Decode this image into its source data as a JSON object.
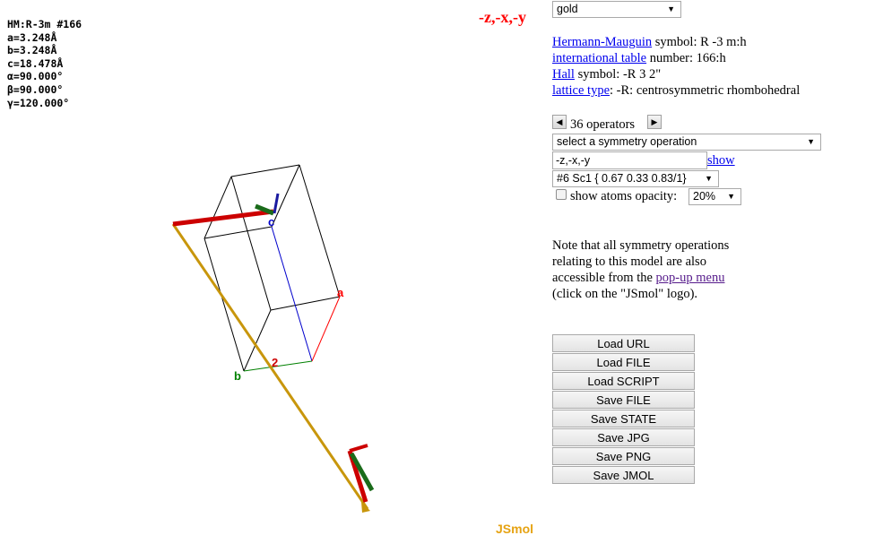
{
  "viewer": {
    "cell_info": [
      "HM:R-3m #166",
      "a=3.248Å",
      "b=3.248Å",
      "c=18.478Å",
      "α=90.000°",
      "β=90.000°",
      "γ=120.000°"
    ],
    "operation_echo": "-z,-x,-y",
    "logo": "JSmol",
    "axis_labels": {
      "a": "a",
      "b": "b",
      "c": "c"
    },
    "colors": {
      "echo": "#ff0000",
      "logo": "#e6a313",
      "axis_a": "#ff0000",
      "axis_b": "#008000",
      "axis_c": "#0000cc",
      "vector": "#c8960c",
      "frame": "#000000"
    }
  },
  "panel": {
    "color_select": "gold",
    "hm_link": "Hermann-Mauguin",
    "hm_text": " symbol: R -3 m:h",
    "it_link": "international table",
    "it_text": " number: 166:h",
    "hall_link": "Hall",
    "hall_text": " symbol: -R 3 2\"",
    "lattice_link": "lattice type",
    "lattice_text": ": -R: centrosymmetric rhombohedral",
    "operators_count": "36 operators",
    "symop_select": "select a symmetry operation",
    "symop_input": "-z,-x,-y",
    "show_link": "show",
    "op_detail_select": "#6 Sc1 { 0.67 0.33 0.83/1}",
    "opacity_label": "show atoms opacity:",
    "opacity_select": "20%",
    "note_1": "Note that all symmetry operations",
    "note_2": "relating to this model are also",
    "note_3_pre": "accessible from the ",
    "note_3_link": "pop-up menu",
    "note_4": "(click on the \"JSmol\" logo).",
    "buttons": [
      "Load URL",
      "Load FILE",
      "Load SCRIPT",
      "Save FILE",
      "Save STATE",
      "Save JPG",
      "Save PNG",
      "Save JMOL"
    ]
  }
}
